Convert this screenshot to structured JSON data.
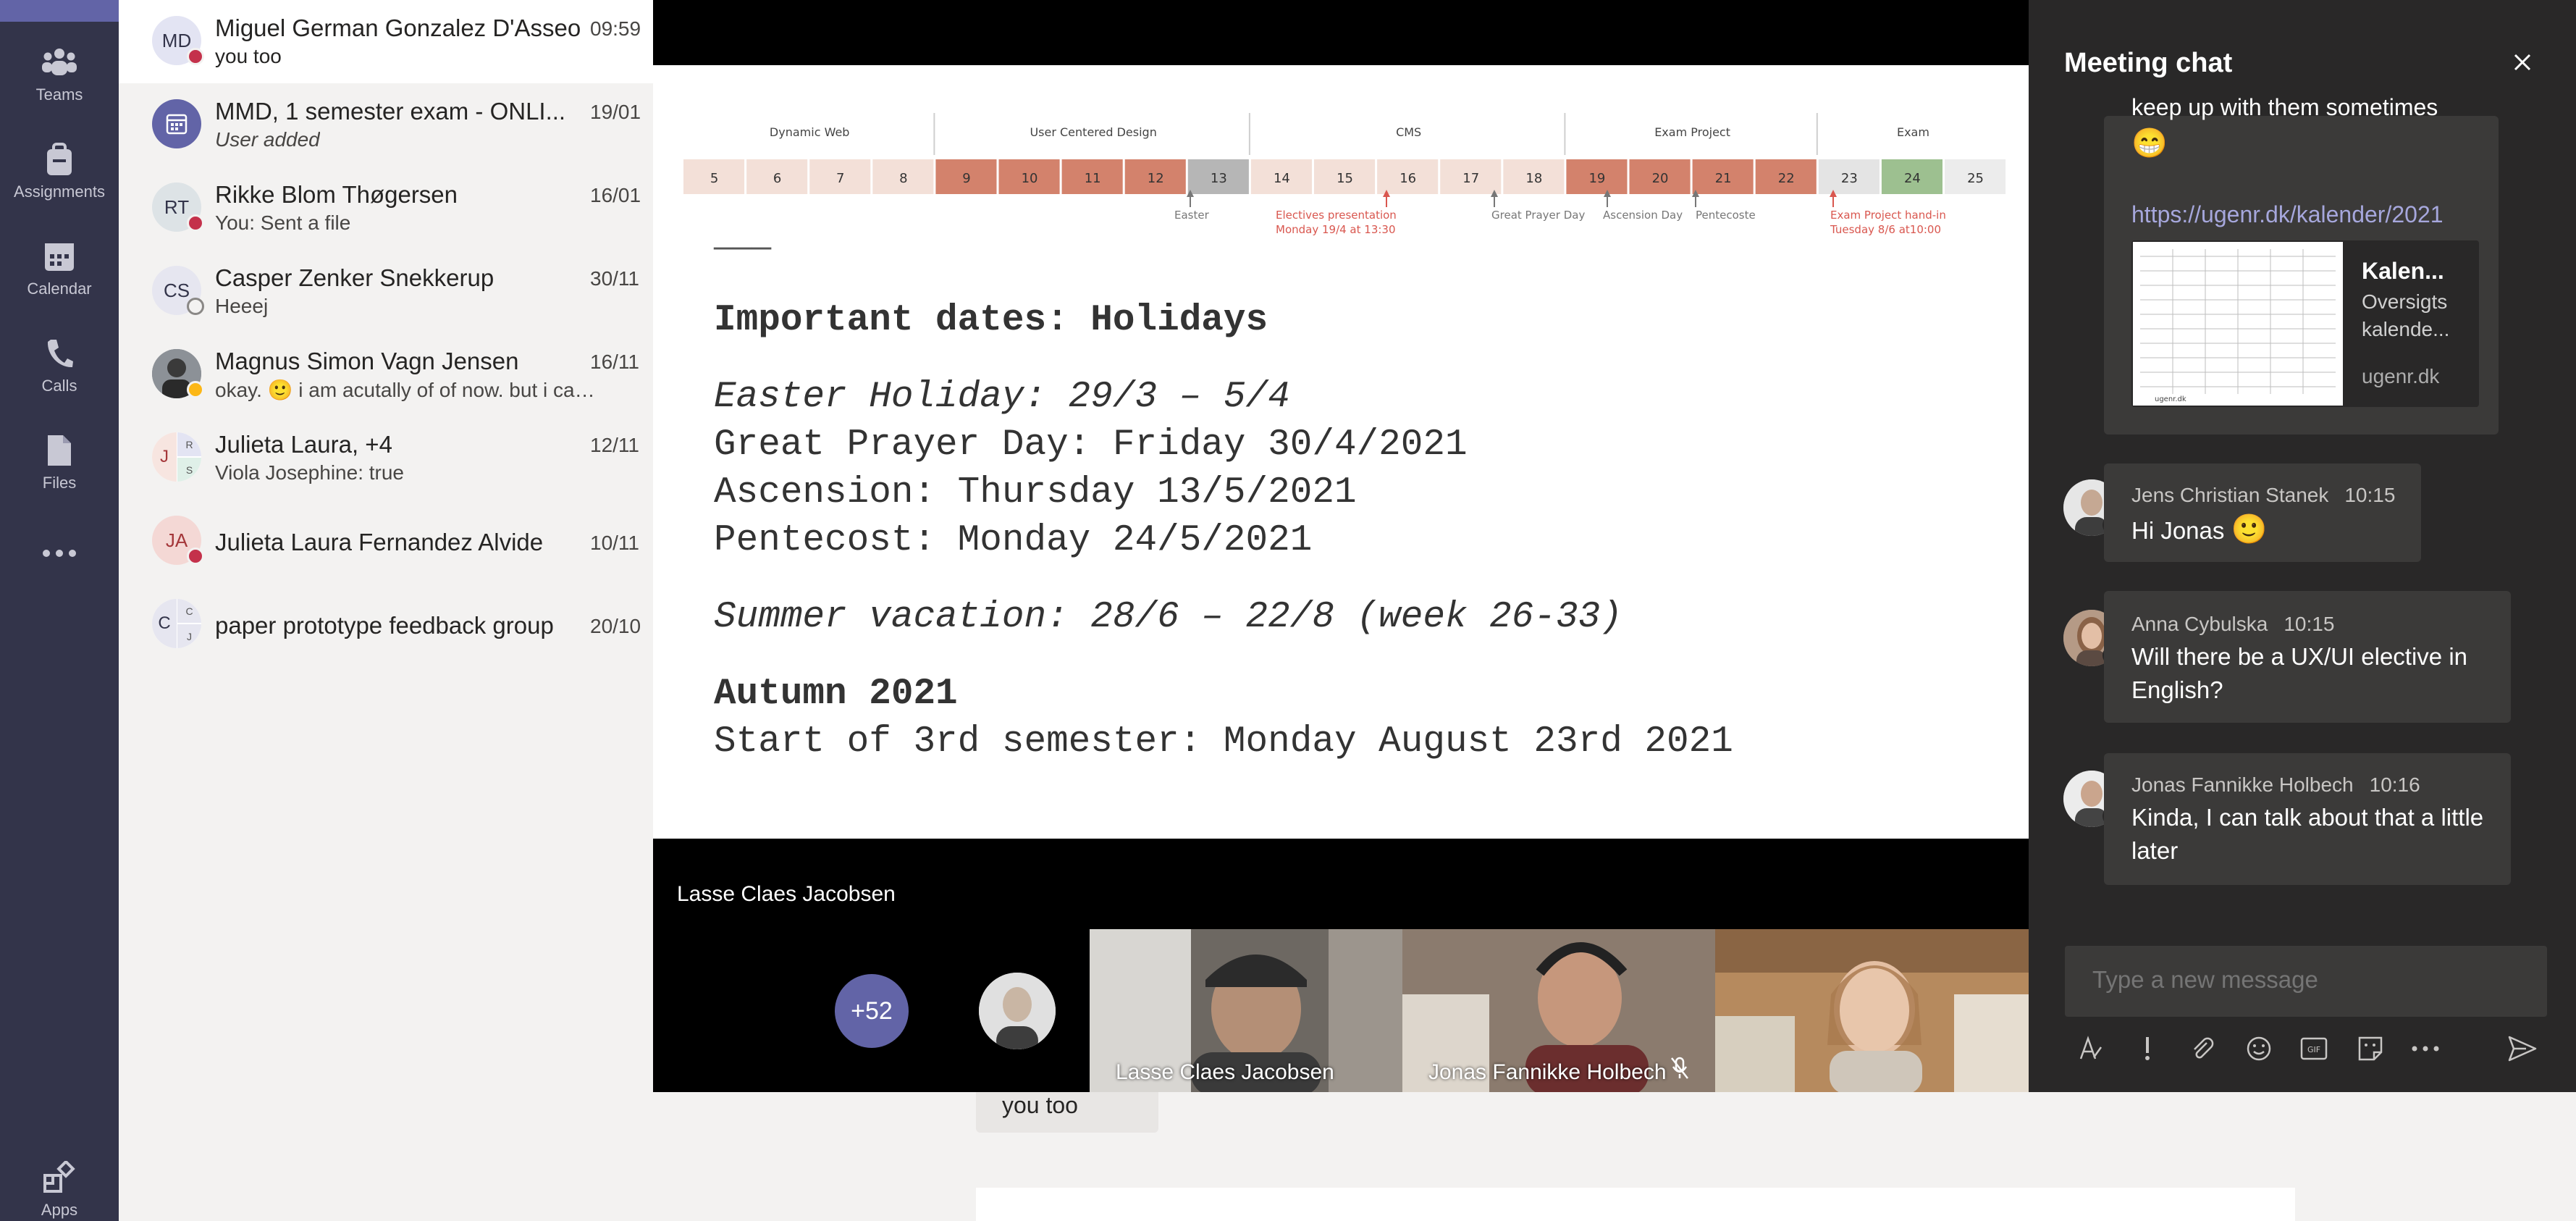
{
  "rail": {
    "items": [
      {
        "label": "Teams",
        "icon": "teams-icon"
      },
      {
        "label": "Assignments",
        "icon": "assignments-icon"
      },
      {
        "label": "Calendar",
        "icon": "calendar-icon"
      },
      {
        "label": "Calls",
        "icon": "calls-icon"
      },
      {
        "label": "Files",
        "icon": "files-icon"
      },
      {
        "label": "",
        "icon": "more-icon"
      },
      {
        "label": "Apps",
        "icon": "apps-icon"
      }
    ],
    "accent": "#6264a7",
    "background": "#33344a"
  },
  "chats": [
    {
      "initials": "MD",
      "name": "Miguel German Gonzalez D'Asseo",
      "date": "09:59",
      "preview": "you too",
      "presence": "busy"
    },
    {
      "initials": "",
      "name": "MMD, 1 semester exam - ONLI...",
      "date": "19/01",
      "preview": "User added",
      "presence": "none"
    },
    {
      "initials": "RT",
      "name": "Rikke Blom Thøgersen",
      "date": "16/01",
      "preview": "You: Sent a file",
      "presence": "busy"
    },
    {
      "initials": "CS",
      "name": "Casper Zenker Snekkerup",
      "date": "30/11",
      "preview": "Heeej",
      "presence": "offline"
    },
    {
      "initials": "",
      "name": "Magnus Simon Vagn Jensen",
      "date": "16/11",
      "preview": "okay. 🙂  i am acutally of of now. but i can h...",
      "presence": "away"
    },
    {
      "initials": "J",
      "name": "Julieta Laura, +4",
      "date": "12/11",
      "preview": "Viola Josephine: true",
      "presence": "none"
    },
    {
      "initials": "JA",
      "name": "Julieta Laura Fernandez Alvide",
      "date": "10/11",
      "preview": "",
      "presence": "busy"
    },
    {
      "initials": "C",
      "name": "paper prototype feedback group",
      "date": "20/10",
      "preview": "",
      "presence": "none"
    }
  ],
  "background_chat": {
    "bubble": "you too"
  },
  "slide": {
    "timeline": {
      "phases": [
        "Dynamic Web",
        "User Centered Design",
        "CMS",
        "Exam Project",
        "Exam"
      ],
      "weeks": [
        "5",
        "6",
        "7",
        "8",
        "9",
        "10",
        "11",
        "12",
        "13",
        "14",
        "15",
        "16",
        "17",
        "18",
        "19",
        "20",
        "21",
        "22",
        "23",
        "24",
        "25"
      ],
      "annotations": [
        "Easter",
        "Electives presentation",
        "Monday 19/4 at 13:30",
        "Great Prayer Day",
        "Ascension Day",
        "Pentecoste",
        "Exam Project hand-in",
        "Tuesday 8/6 at10:00"
      ]
    },
    "divider": "———",
    "heading_holidays": "Important dates: Holidays",
    "easter": "Easter Holiday: 29/3 – 5/4",
    "prayer": "Great Prayer Day: Friday 30/4/2021",
    "ascension": "Ascension: Thursday 13/5/2021",
    "pentecost": "Pentecost: Monday 24/5/2021",
    "summer": "Summer vacation: 28/6 – 22/8 (week 26-33)",
    "heading_autumn": "Autumn 2021",
    "start": "Start of 3rd semester: Monday August 23rd 2021"
  },
  "meeting": {
    "presenter": "Lasse Claes Jacobsen",
    "more_participants": "+52",
    "tiles": [
      {
        "name": "Lasse Claes Jacobsen",
        "muted": false
      },
      {
        "name": "Jonas Fannikke Holbech",
        "muted": true
      },
      {
        "name": "",
        "muted": false
      }
    ]
  },
  "meeting_chat": {
    "title": "Meeting chat",
    "partial_message": "keep up with them sometimes",
    "partial_emoji": "😁",
    "link": "https://ugenr.dk/kalender/2021",
    "link_preview": {
      "title": "Kalen...",
      "description": "Oversigts kalende...",
      "domain": "ugenr.dk",
      "thumb_label": "ugenr.dk"
    },
    "messages": [
      {
        "author": "Jens Christian Stanek",
        "time": "10:15",
        "text": "Hi Jonas",
        "emoji": "🙂",
        "presence": "busy"
      },
      {
        "author": "Anna Cybulska",
        "time": "10:15",
        "text": "Will there be a UX/UI elective in English?",
        "presence": "busy"
      },
      {
        "author": "Jonas Fannikke Holbech",
        "time": "10:16",
        "text": "Kinda, I can talk about that a little later",
        "presence": "dnd"
      }
    ],
    "compose_placeholder": "Type a new message",
    "tools": [
      "format-icon",
      "important-icon",
      "attach-icon",
      "emoji-icon",
      "gif-icon",
      "sticker-icon",
      "more-options-icon",
      "send-icon"
    ]
  }
}
